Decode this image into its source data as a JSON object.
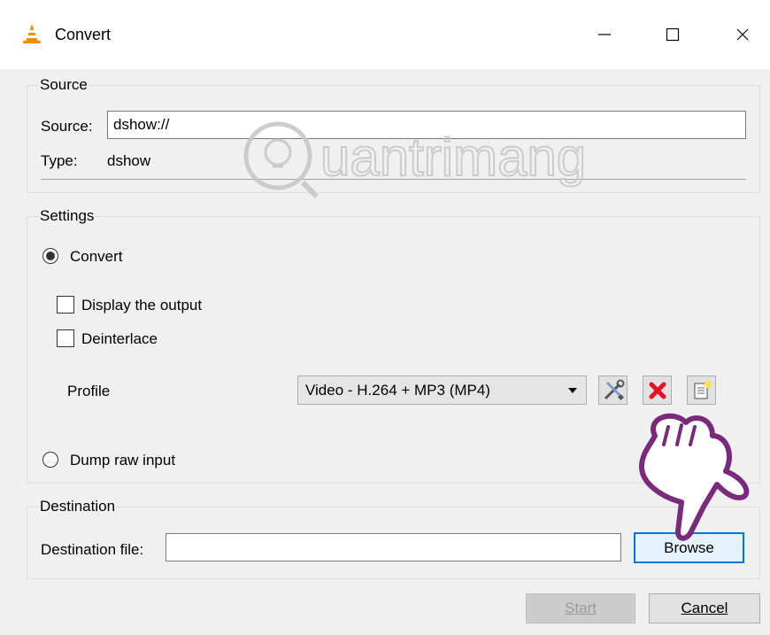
{
  "window": {
    "title": "Convert",
    "icon": "vlc-cone-icon"
  },
  "source": {
    "group_title": "Source",
    "source_label": "Source:",
    "source_value": "dshow://",
    "type_label": "Type:",
    "type_value": "dshow"
  },
  "settings": {
    "group_title": "Settings",
    "convert_label": "Convert",
    "convert_selected": true,
    "display_output_label": "Display the output",
    "deinterlace_label": "Deinterlace",
    "profile_label": "Profile",
    "profile_value": "Video - H.264 + MP3 (MP4)",
    "dump_raw_label": "Dump raw input"
  },
  "destination": {
    "group_title": "Destination",
    "file_label": "Destination file:",
    "file_value": "",
    "browse_label": "Browse"
  },
  "footer": {
    "start_label": "Start",
    "cancel_label": "Cancel"
  },
  "watermark": {
    "text": "uantrimang"
  },
  "colors": {
    "accent": "#0078d7",
    "delete_red": "#e81123"
  }
}
